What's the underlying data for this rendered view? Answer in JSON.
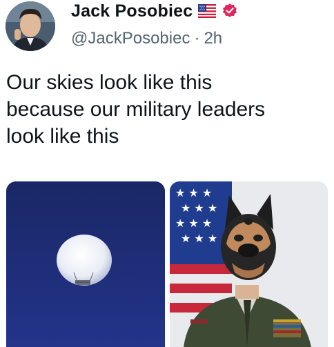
{
  "author": {
    "display_name": "Jack Posobiec",
    "handle": "@JackPosobiec",
    "separator": "·",
    "time_ago": "2h",
    "icons": [
      "us-flag-icon",
      "verified-badge-icon"
    ],
    "verified_color": "#e0245e"
  },
  "tweet": {
    "text": "Our skies look like this\nbecause our military leaders\nlook like this"
  },
  "media": [
    {
      "name": "balloon-photo"
    },
    {
      "name": "officer-mask-photo"
    }
  ],
  "colors": {
    "handle_gray": "#536471",
    "sky_blue": "#1c2a7a"
  }
}
